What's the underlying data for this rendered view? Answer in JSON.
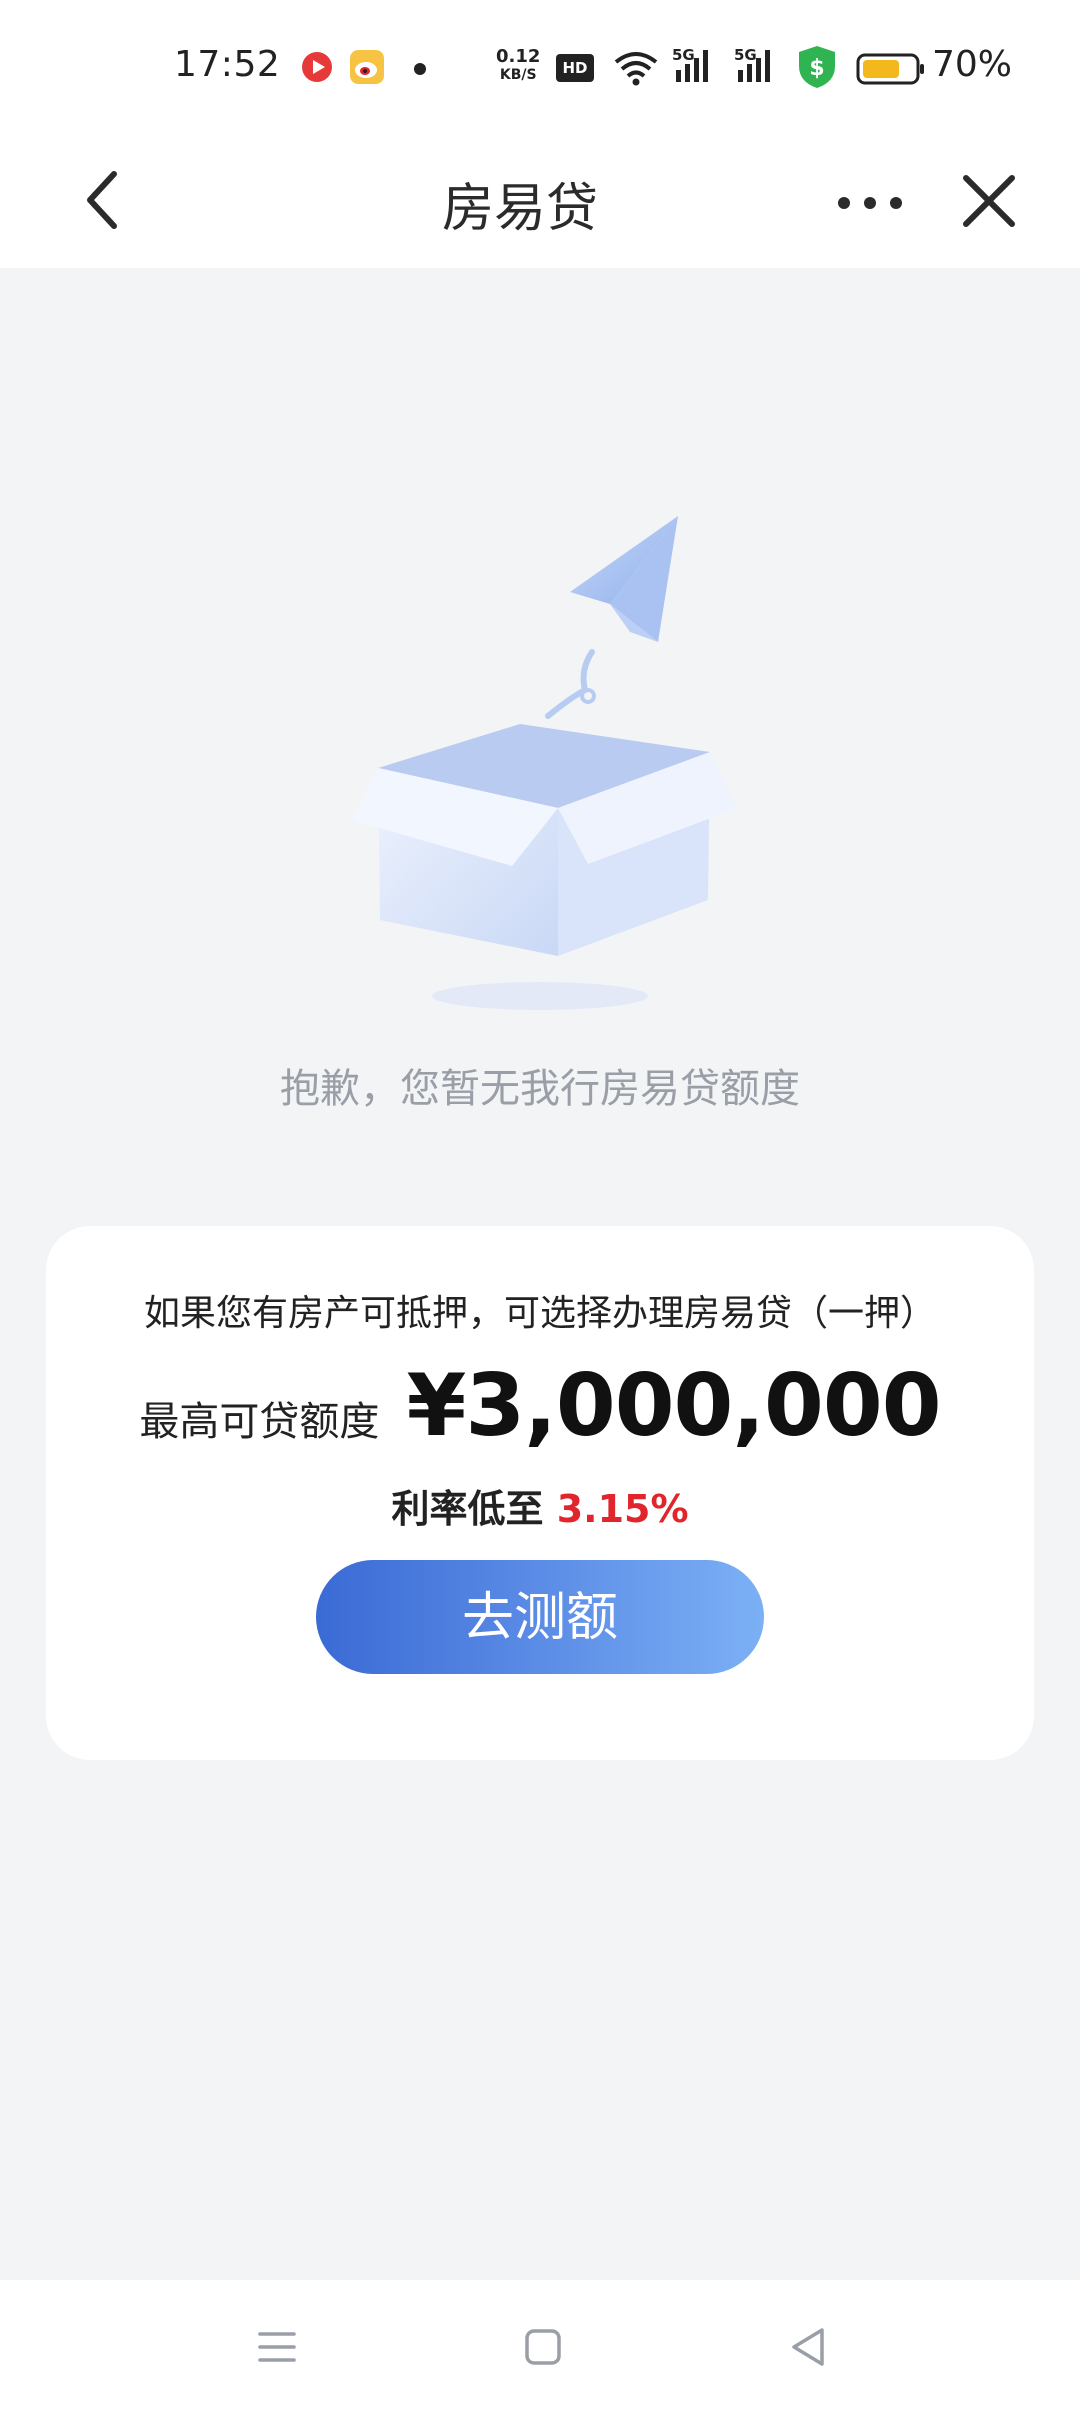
{
  "status_bar": {
    "time": "17:52",
    "net_speed_value": "0.12",
    "net_speed_unit": "KB/S",
    "hd_badge": "HD",
    "sig1_label": "5G",
    "sig2_label": "5G",
    "battery_percent": "70%",
    "icons": [
      "video-app-icon",
      "weibo-icon",
      "notification-dot",
      "hd-icon",
      "wifi-icon",
      "signal-5g-icon",
      "signal-5g-icon",
      "security-shield-icon",
      "battery-icon"
    ]
  },
  "header": {
    "title": "房易贷",
    "icons": [
      "back-icon",
      "more-icon",
      "close-icon"
    ]
  },
  "empty_state": {
    "message": "抱歉，您暂无我行房易贷额度"
  },
  "card": {
    "hint": "如果您有房产可抵押，可选择办理房易贷（一押）",
    "amount_label": "最高可贷额度",
    "amount_value": "¥3,000,000",
    "rate_label": "利率低至",
    "rate_value": "3.15%",
    "cta_label": "去测额"
  },
  "colors": {
    "accent_start": "#3a6ad4",
    "accent_end": "#7cb0f5",
    "rate_red": "#e0262c"
  }
}
